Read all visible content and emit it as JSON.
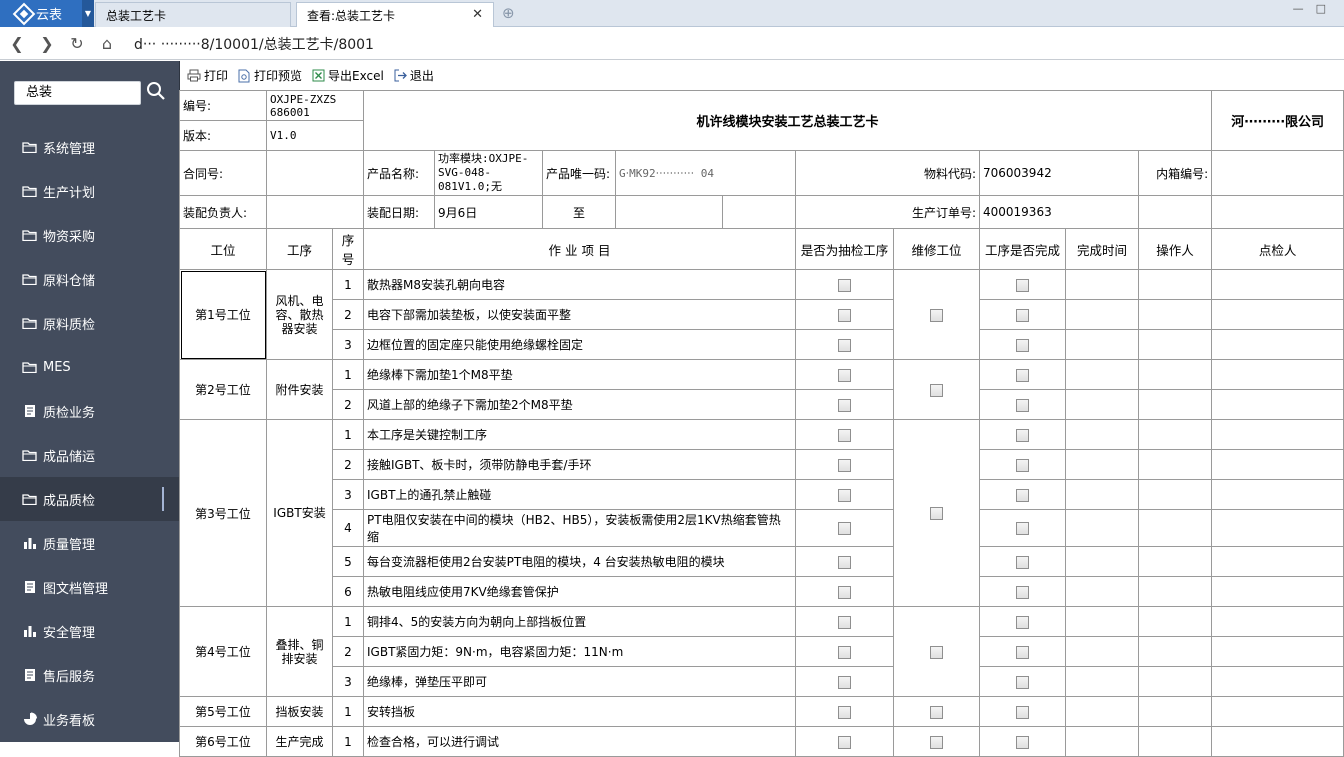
{
  "browser": {
    "app_name": "云表",
    "tabs": [
      {
        "label": "总装工艺卡",
        "active": false
      },
      {
        "label": "查看:总装工艺卡",
        "active": true
      }
    ],
    "url": "d‧‧‧ ‧‧‧‧‧‧‧‧‧8/10001/总装工艺卡/8001"
  },
  "sidebar": {
    "search_value": "总装",
    "items": [
      {
        "label": "系统管理",
        "icon": "folder-icon"
      },
      {
        "label": "生产计划",
        "icon": "folder-icon"
      },
      {
        "label": "物资采购",
        "icon": "folder-icon"
      },
      {
        "label": "原料仓储",
        "icon": "folder-icon"
      },
      {
        "label": "原料质检",
        "icon": "folder-icon"
      },
      {
        "label": "MES",
        "icon": "folder-icon"
      },
      {
        "label": "质检业务",
        "icon": "document-icon"
      },
      {
        "label": "成品储运",
        "icon": "folder-icon"
      },
      {
        "label": "成品质检",
        "icon": "folder-icon",
        "active": true
      },
      {
        "label": "质量管理",
        "icon": "bar-chart-icon"
      },
      {
        "label": "图文档管理",
        "icon": "document-icon"
      },
      {
        "label": "安全管理",
        "icon": "bar-chart-icon"
      },
      {
        "label": "售后服务",
        "icon": "document-icon"
      },
      {
        "label": "业务看板",
        "icon": "pie-chart-icon"
      }
    ]
  },
  "toolbar": {
    "print": "打印",
    "preview": "打印预览",
    "export": "导出Excel",
    "exit": "退出"
  },
  "form": {
    "code_label": "编号:",
    "code_value": "OXJPE-ZXZS 686001",
    "version_label": "版本:",
    "version_value": "V1.0",
    "title": "机许线模块安装工艺总装工艺卡",
    "company": "河‧‧‧‧‧‧‧‧‧限公司",
    "contract_label": "合同号:",
    "product_name_label": "产品名称:",
    "product_name_value": "功率模块:OXJPE-SVG-048-081V1.0;无",
    "product_uid_label": "产品唯一码:",
    "product_uid_value": "G‧MK92‧‧‧‧‧‧‧‧‧‧‧ 04",
    "material_label": "物料代码:",
    "material_value": "706003942",
    "box_label": "内箱编号:",
    "assembler_label": "装配负责人:",
    "date_label": "装配日期:",
    "date_value": "9月6日",
    "to_label": "至",
    "order_label": "生产订单号:",
    "order_value": "400019363"
  },
  "headers": {
    "station": "工位",
    "process": "工序",
    "seq": "序号",
    "item": "作 业 项 目",
    "spot_check": "是否为抽检工序",
    "repair": "维修工位",
    "done": "工序是否完成",
    "finish_time": "完成时间",
    "operator": "操作人",
    "inspector": "点检人"
  },
  "groups": [
    {
      "station": "第1号工位",
      "process": "风机、电容、散热器安装",
      "items": [
        "散热器M8安装孔朝向电容",
        "电容下部需加装垫板，以使安装面平整",
        "边框位置的固定座只能使用绝缘螺栓固定"
      ]
    },
    {
      "station": "第2号工位",
      "process": "附件安装",
      "items": [
        "绝缘棒下需加垫1个M8平垫",
        "风道上部的绝缘子下需加垫2个M8平垫"
      ]
    },
    {
      "station": "第3号工位",
      "process": "IGBT安装",
      "items": [
        "本工序是关键控制工序",
        "接触IGBT、板卡时，须带防静电手套/手环",
        "IGBT上的通孔禁止触碰",
        "PT电阻仅安装在中间的模块（HB2、HB5），安装板需使用2层1KV热缩套管热缩",
        "每台变流器柜使用2台安装PT电阻的模块，4 台安装热敏电阻的模块",
        "热敏电阻线应使用7KV绝缘套管保护"
      ]
    },
    {
      "station": "第4号工位",
      "process": "叠排、铜排安装",
      "items": [
        "铜排4、5的安装方向为朝向上部挡板位置",
        "IGBT紧固力矩：9N·m，电容紧固力矩：11N·m",
        "绝缘棒，弹垫压平即可"
      ]
    },
    {
      "station": "第5号工位",
      "process": "挡板安装",
      "items": [
        "安转挡板"
      ]
    },
    {
      "station": "第6号工位",
      "process": "生产完成",
      "items": [
        "检查合格，可以进行调试"
      ]
    }
  ]
}
